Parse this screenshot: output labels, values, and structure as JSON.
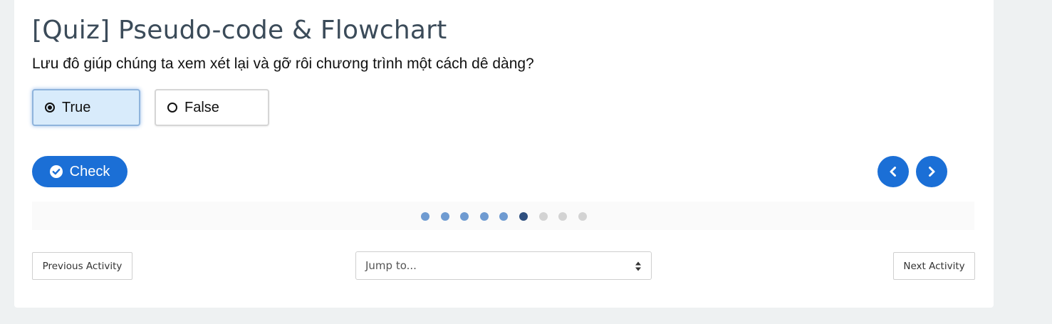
{
  "quiz": {
    "title": "[Quiz] Pseudo-code & Flowchart",
    "question": "Lưu đô giúp chúng ta xem xét lại và gỡ rôi chương trình một cách dê dàng?",
    "options": [
      {
        "label": "True",
        "selected": true
      },
      {
        "label": "False",
        "selected": false
      }
    ],
    "check_label": "Check",
    "progress": {
      "total": 9,
      "current": 6
    }
  },
  "navigation": {
    "previous_label": "Previous Activity",
    "next_label": "Next Activity",
    "jump_placeholder": "Jump to..."
  },
  "colors": {
    "accent": "#1b6fd6",
    "dot_done": "#6f9bd1",
    "dot_current": "#2e4f7e",
    "dot_todo": "#d3d3d3",
    "selected_bg": "#d8ebfb"
  }
}
